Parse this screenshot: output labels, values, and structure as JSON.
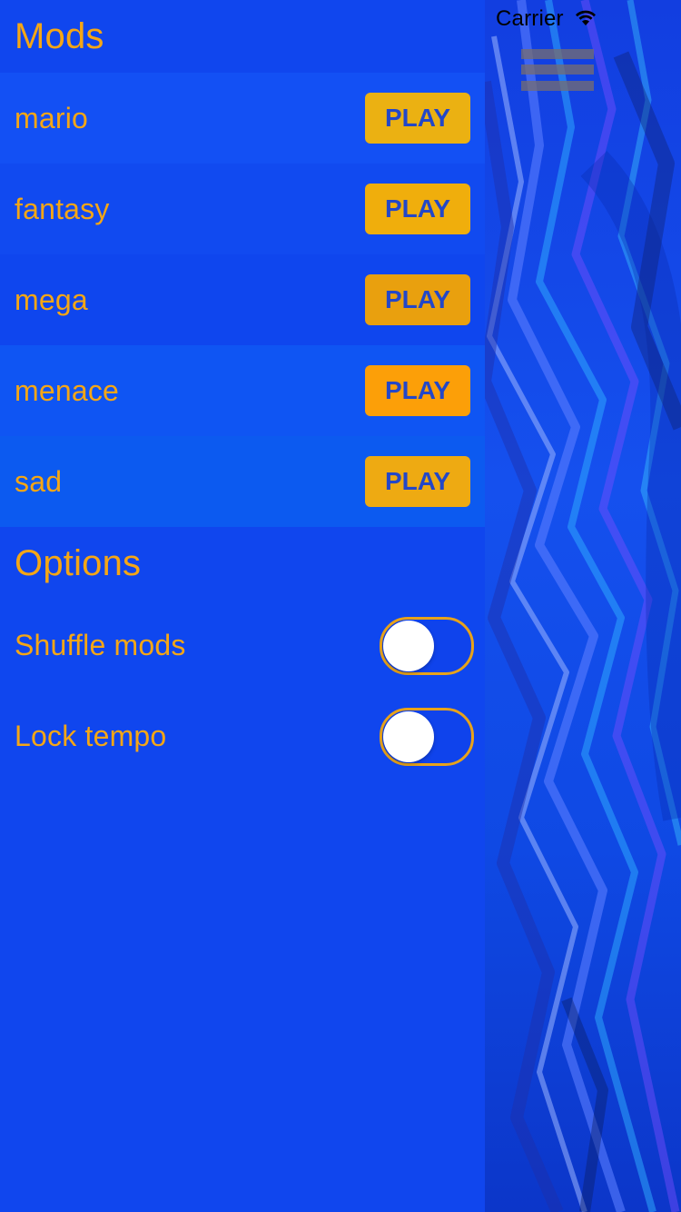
{
  "status_bar": {
    "carrier": "Carrier",
    "wifi_icon": "wifi-icon"
  },
  "menu": {
    "icon": "hamburger-menu-icon"
  },
  "mods": {
    "title": "Mods",
    "items": [
      {
        "name": "mario",
        "button": "PLAY",
        "row_color": "#1350f4",
        "button_color": "#ebb112"
      },
      {
        "name": "fantasy",
        "button": "PLAY",
        "row_color": "#114af0",
        "button_color": "#f0ae0c"
      },
      {
        "name": "mega",
        "button": "PLAY",
        "row_color": "#0f46ee",
        "button_color": "#e9a00e"
      },
      {
        "name": "menace",
        "button": "PLAY",
        "row_color": "#0f55f3",
        "button_color": "#fc9f08"
      },
      {
        "name": "sad",
        "button": "PLAY",
        "row_color": "#0c5af0",
        "button_color": "#eeaa12"
      }
    ]
  },
  "options": {
    "title": "Options",
    "items": [
      {
        "label": "Shuffle mods",
        "enabled": false,
        "row_color": "#0f47ef"
      },
      {
        "label": "Lock tempo",
        "enabled": false,
        "row_color": "#1046ee"
      }
    ]
  },
  "colors": {
    "accent": "#f5a615",
    "drawer_bg": "#1046ee",
    "button_text": "#2347c8"
  }
}
